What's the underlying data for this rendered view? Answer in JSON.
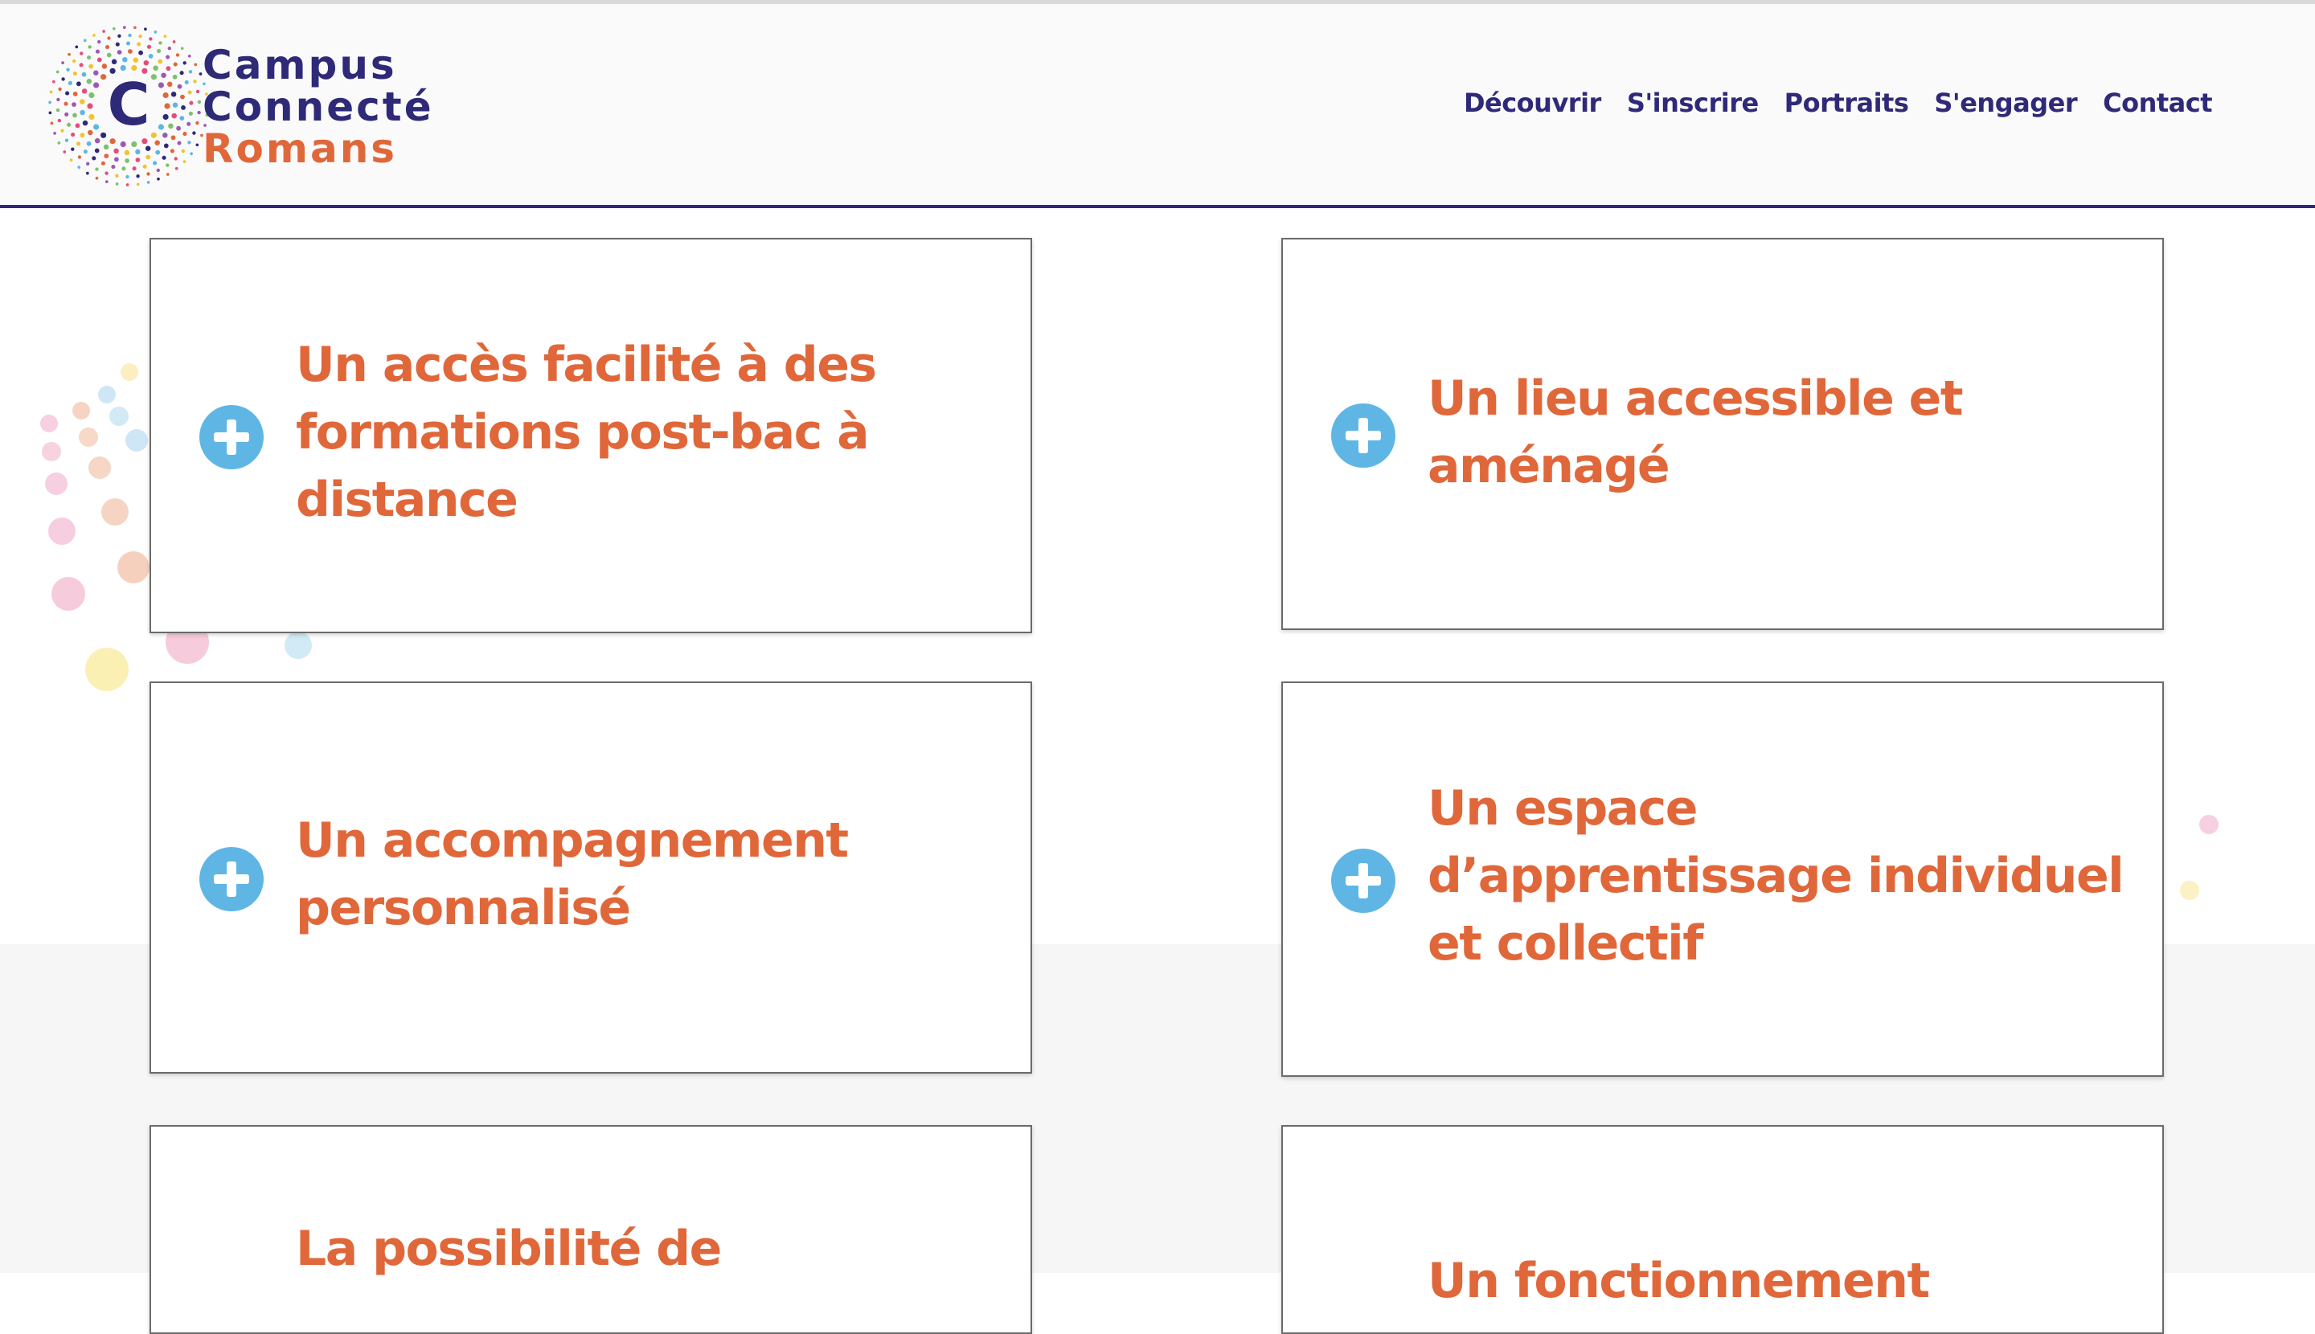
{
  "brand": {
    "logo_letter": "C",
    "line1": "Campus",
    "line2": "Connecté",
    "line3": "Romans",
    "colors": {
      "navy": "#2e2a78",
      "orange": "#e0673a",
      "plus_blue": "#5fb6e5"
    }
  },
  "nav": {
    "items": [
      {
        "label": "Découvrir"
      },
      {
        "label": "S'inscrire"
      },
      {
        "label": "Portraits"
      },
      {
        "label": "S'engager"
      },
      {
        "label": "Contact"
      }
    ]
  },
  "cards": [
    {
      "title": "Un accès facilité à des formations post-bac à distance",
      "icon": "plus-circle-icon"
    },
    {
      "title": "Un lieu accessible et aménagé",
      "icon": "plus-circle-icon"
    },
    {
      "title": "Un accompagnement personnalisé",
      "icon": "plus-circle-icon"
    },
    {
      "title": "Un espace d’apprentissage individuel et collectif",
      "icon": "plus-circle-icon"
    },
    {
      "title": "La possibilité de",
      "icon": "plus-circle-icon"
    },
    {
      "title": "Un fonctionnement",
      "icon": "plus-circle-icon"
    }
  ]
}
